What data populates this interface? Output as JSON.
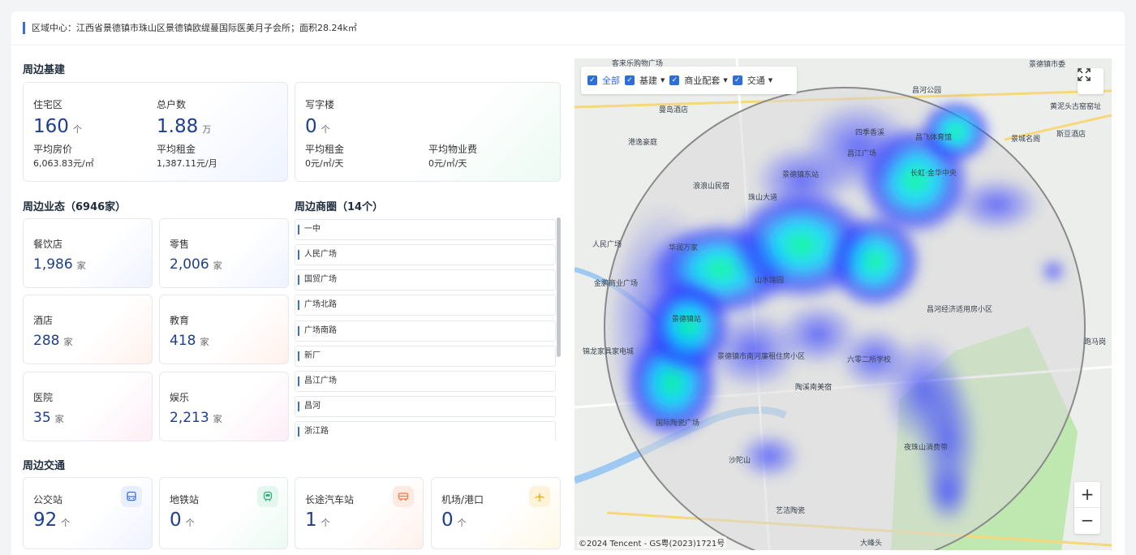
{
  "header": {
    "region_info": "区域中心：江西省景德镇市珠山区景德镇欧缇蔓国际医美月子会所；面积28.24k㎡"
  },
  "infrastructure": {
    "title": "周边基建",
    "residential": {
      "label": "住宅区",
      "value": "160",
      "unit": "个",
      "avg_price_label": "平均房价",
      "avg_price": "6,063.83元/㎡"
    },
    "households": {
      "label": "总户数",
      "value": "1.88",
      "unit": "万",
      "avg_rent_label": "平均租金",
      "avg_rent": "1,387.11元/月"
    },
    "office": {
      "label": "写字楼",
      "value": "0",
      "unit": "个",
      "avg_rent_label": "平均租金",
      "avg_rent": "0元/㎡/天",
      "avg_fee_label": "平均物业费",
      "avg_fee": "0元/㎡/天"
    }
  },
  "business": {
    "title": "周边业态（6946家）",
    "items": [
      {
        "label": "餐饮店",
        "value": "1,986",
        "unit": "家"
      },
      {
        "label": "零售",
        "value": "2,006",
        "unit": "家"
      },
      {
        "label": "酒店",
        "value": "288",
        "unit": "家"
      },
      {
        "label": "教育",
        "value": "418",
        "unit": "家"
      },
      {
        "label": "医院",
        "value": "35",
        "unit": "家"
      },
      {
        "label": "娱乐",
        "value": "2,213",
        "unit": "家"
      }
    ]
  },
  "districts": {
    "title": "周边商圈（14个）",
    "items": [
      "一中",
      "人民广场",
      "国贸广场",
      "广场北路",
      "广场南路",
      "新厂",
      "昌江广场",
      "昌河",
      "浙江路"
    ]
  },
  "transport": {
    "title": "周边交通",
    "items": [
      {
        "label": "公交站",
        "value": "92",
        "unit": "个",
        "icon": "bus-icon",
        "color": "#3b6fd8"
      },
      {
        "label": "地铁站",
        "value": "0",
        "unit": "个",
        "icon": "subway-icon",
        "color": "#27b47a"
      },
      {
        "label": "长途汽车站",
        "value": "1",
        "unit": "个",
        "icon": "coach-icon",
        "color": "#f07a4a"
      },
      {
        "label": "机场/港口",
        "value": "0",
        "unit": "个",
        "icon": "airplane-icon",
        "color": "#f0b429"
      }
    ]
  },
  "map": {
    "filters": [
      {
        "label": "全部",
        "checked": true,
        "dropdown": false
      },
      {
        "label": "基建",
        "checked": true,
        "dropdown": true
      },
      {
        "label": "商业配套",
        "checked": true,
        "dropdown": true
      },
      {
        "label": "交通",
        "checked": true,
        "dropdown": true
      }
    ],
    "labels": [
      "客来乐购物广场",
      "景德镇市委",
      "曼岛酒店",
      "港逸豪庭",
      "浪浪山民宿",
      "景德镇东站",
      "珠山大道",
      "人民广场",
      "金鹏商业广场",
      "山水瑞园",
      "昌河经济适用房小区",
      "景德镇市南河廉租住房小区",
      "六零二所学校",
      "陶溪南美宿",
      "国际陶瓷广场",
      "沙陀山",
      "艺洁陶瓷",
      "夜珠山消费带",
      "大峰头",
      "昌河公园",
      "黄泥头古窑窑址",
      "斯豆酒店",
      "景城名阁",
      "跑马岗",
      "锦龙家具家电城",
      "华润万家",
      "景德镇站",
      "四季香溪",
      "昌飞体育馆",
      "长虹·金华中央",
      "昌江广场"
    ],
    "copyright": "©2024 Tencent - GS粤(2023)1721号",
    "zoom_in": "+",
    "zoom_out": "−"
  }
}
